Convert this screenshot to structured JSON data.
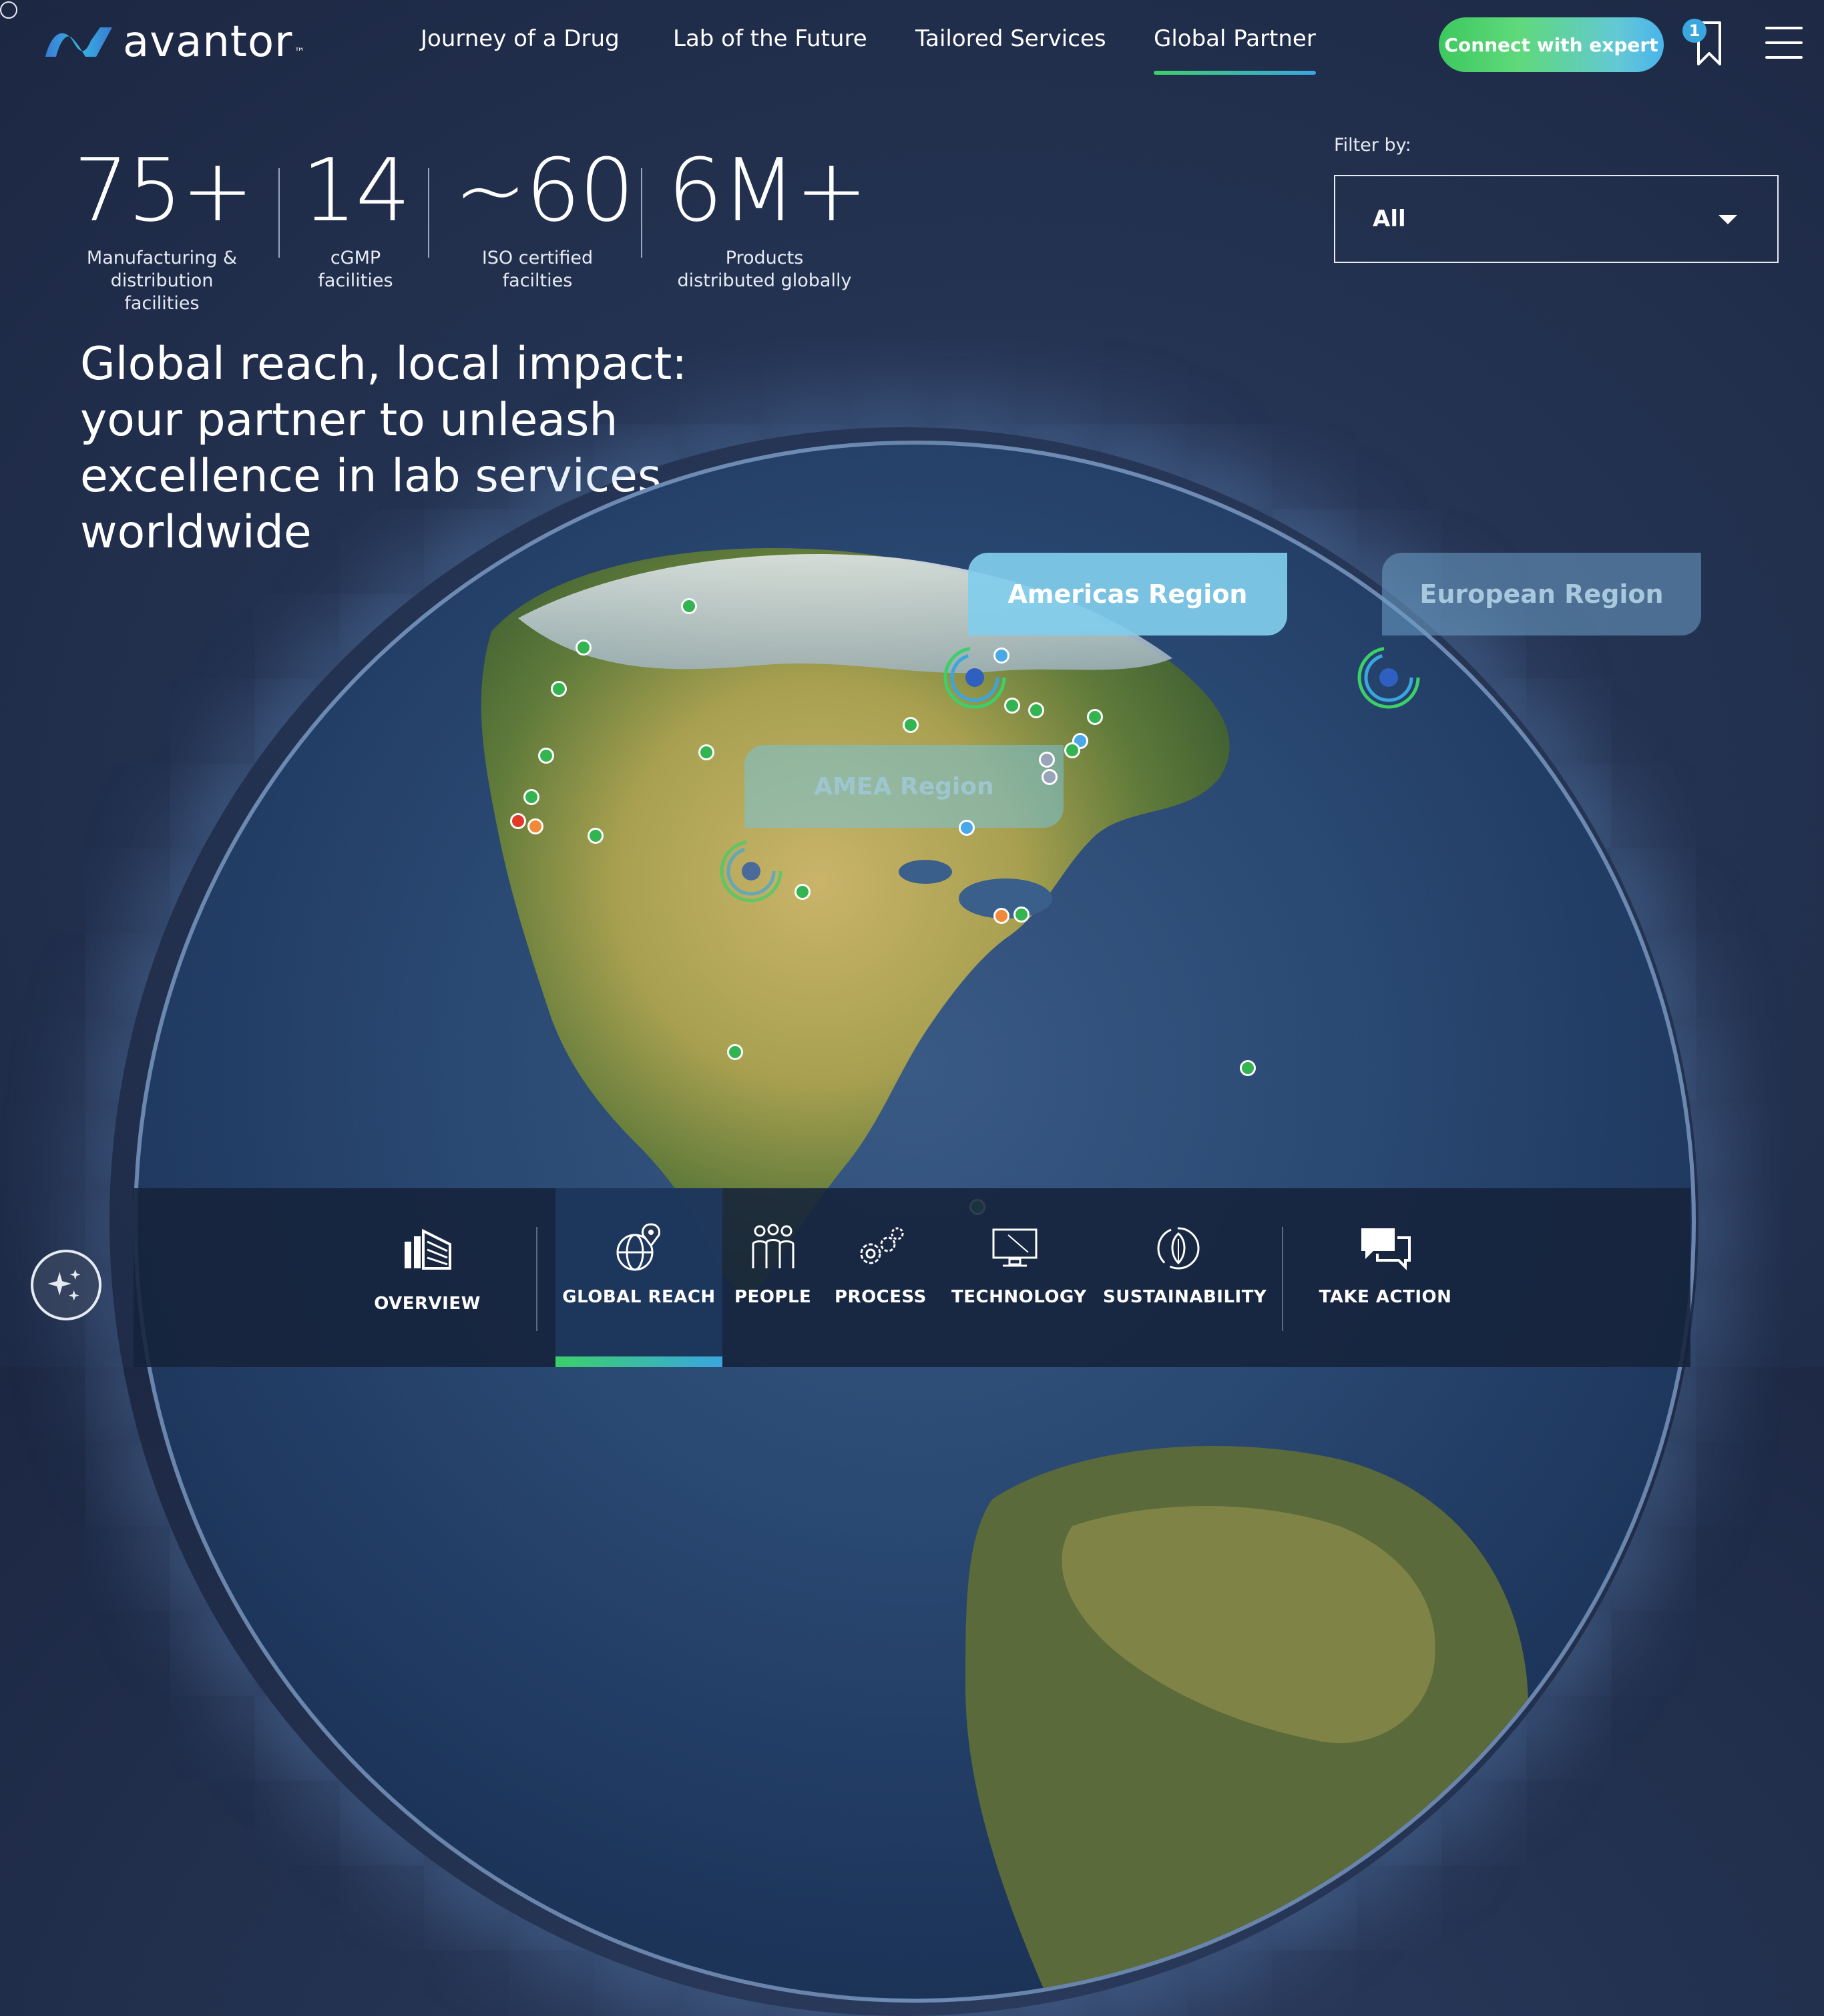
{
  "brand": {
    "name": "avantor",
    "tm": "™"
  },
  "nav": {
    "items": [
      {
        "label": "Journey of a Drug",
        "active": false
      },
      {
        "label": "Lab of the Future",
        "active": false
      },
      {
        "label": "Tailored Services",
        "active": false
      },
      {
        "label": "Global Partner",
        "active": true
      }
    ],
    "cta_label": "Connect with expert",
    "bookmark_count": "1"
  },
  "stats": [
    {
      "value": "75+",
      "label_line1": "Manufacturing &",
      "label_line2": "distribution facilities"
    },
    {
      "value": "14",
      "label_line1": "cGMP",
      "label_line2": "facilities"
    },
    {
      "value": "~60",
      "label_line1": "ISO certified",
      "label_line2": "facilties"
    },
    {
      "value": "6M+",
      "label_line1": "Products",
      "label_line2": "distributed globally"
    }
  ],
  "filter": {
    "label": "Filter by:",
    "selected": "All"
  },
  "headline": "Global reach, local impact: your partner to unleash excellence in lab services worldwide",
  "regions": {
    "americas": "Americas Region",
    "europe": "European Region",
    "amea": "AMEA Region"
  },
  "bottom_nav": {
    "items": [
      {
        "label": "OVERVIEW",
        "icon": "building-icon"
      },
      {
        "label": "GLOBAL REACH",
        "icon": "globe-pin-icon",
        "active": true
      },
      {
        "label": "PEOPLE",
        "icon": "people-icon"
      },
      {
        "label": "PROCESS",
        "icon": "gears-icon"
      },
      {
        "label": "TECHNOLOGY",
        "icon": "monitor-icon"
      },
      {
        "label": "SUSTAINABILITY",
        "icon": "leaf-icon"
      },
      {
        "label": "TAKE ACTION",
        "icon": "chat-icon"
      }
    ]
  },
  "colors": {
    "accent_green": "#3ccf6a",
    "accent_blue": "#3aa6e0",
    "background": "#243352"
  }
}
